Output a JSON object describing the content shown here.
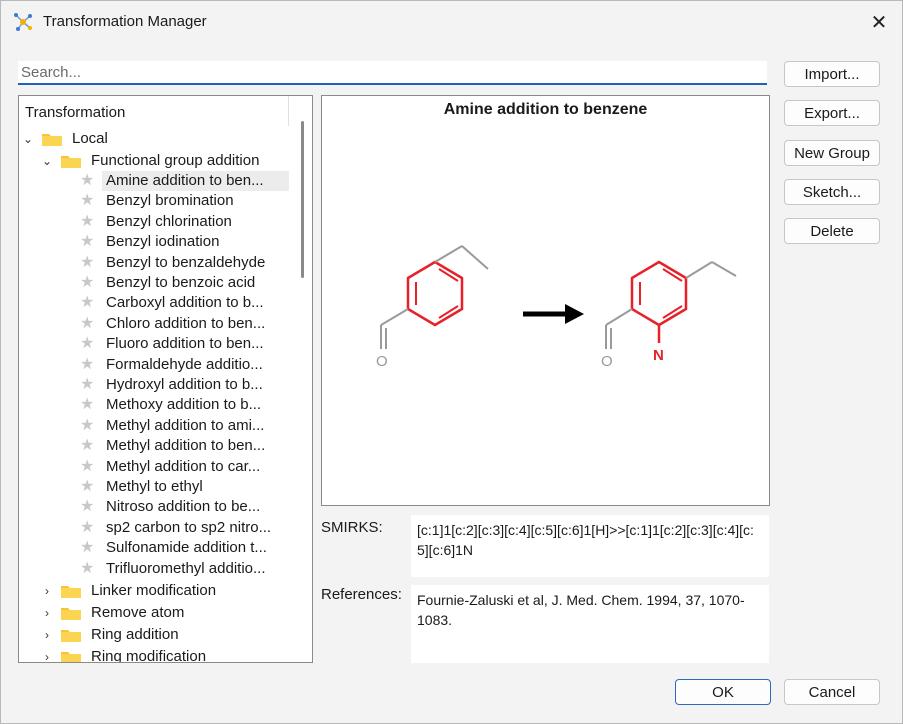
{
  "window": {
    "title": "Transformation Manager",
    "app_icon": "molecule-icon",
    "close_icon": "close-icon"
  },
  "search": {
    "placeholder": "Search...",
    "value": ""
  },
  "buttons": {
    "import": "Import...",
    "export": "Export...",
    "new_group": "New Group",
    "sketch": "Sketch...",
    "delete": "Delete",
    "ok": "OK",
    "cancel": "Cancel"
  },
  "tree": {
    "header": "Transformation",
    "root": "Local",
    "group": "Functional group addition",
    "items": [
      "Amine addition to ben...",
      "Benzyl bromination",
      "Benzyl chlorination",
      "Benzyl iodination",
      "Benzyl to benzaldehyde",
      "Benzyl to benzoic acid",
      "Carboxyl addition to b...",
      "Chloro addition to ben...",
      "Fluoro addition to ben...",
      "Formaldehyde additio...",
      "Hydroxyl addition to b...",
      "Methoxy addition to b...",
      "Methyl addition to ami...",
      "Methyl addition to ben...",
      "Methyl addition to car...",
      "Methyl to ethyl",
      "Nitroso addition to be...",
      "sp2 carbon to sp2 nitro...",
      "Sulfonamide addition t...",
      "Trifluoromethyl additio..."
    ],
    "selected_index": 0,
    "collapsed_groups": [
      "Linker modification",
      "Remove atom",
      "Ring addition",
      "Ring modification"
    ]
  },
  "preview": {
    "title": "Amine addition to benzene",
    "reactant_atom_label": "O",
    "product_atom_labels": {
      "oxygen": "O",
      "nitrogen": "N"
    },
    "highlight_color": "#e8202a",
    "bond_color": "#9a9a9a"
  },
  "details": {
    "smirks_label": "SMIRKS:",
    "smirks_value": "[c:1]1[c:2][c:3][c:4][c:5][c:6]1[H]>>[c:1]1[c:2][c:3][c:4][c:5][c:6]1N",
    "references_label": "References:",
    "references_value": "Fournie-Zaluski et al, J. Med. Chem. 1994, 37, 1070-1083."
  },
  "colors": {
    "accent": "#1f63b5",
    "folder": "#f7c531"
  }
}
